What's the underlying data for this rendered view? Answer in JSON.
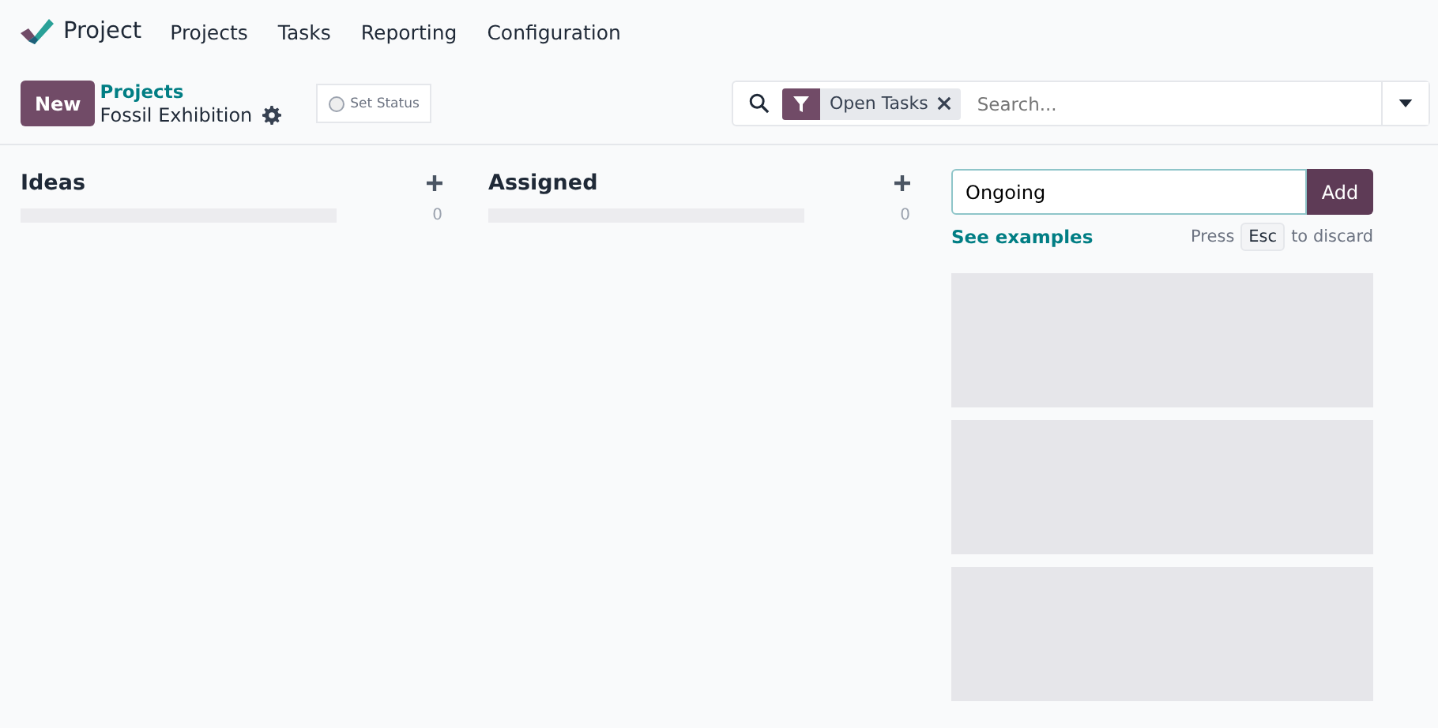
{
  "app": {
    "name": "Project"
  },
  "menu": [
    "Projects",
    "Tasks",
    "Reporting",
    "Configuration"
  ],
  "control_panel": {
    "new_button": "New",
    "breadcrumb": "Projects",
    "record_title": "Fossil Exhibition",
    "status_button": "Set Status"
  },
  "search": {
    "facets": [
      {
        "label": "Open Tasks"
      }
    ],
    "placeholder": "Search..."
  },
  "columns": [
    {
      "title": "Ideas",
      "count": "0",
      "level": 0
    },
    {
      "title": "Assigned",
      "count": "0",
      "level": 0
    }
  ],
  "new_column": {
    "value": "Ongoing",
    "add_button": "Add",
    "examples_link": "See examples",
    "hint_before": "Press",
    "hint_key": "Esc",
    "hint_after": "to discard",
    "cards": [
      {
        "kind": "placeholder"
      },
      {
        "kind": "placeholder"
      },
      {
        "kind": "placeholder"
      }
    ]
  }
}
